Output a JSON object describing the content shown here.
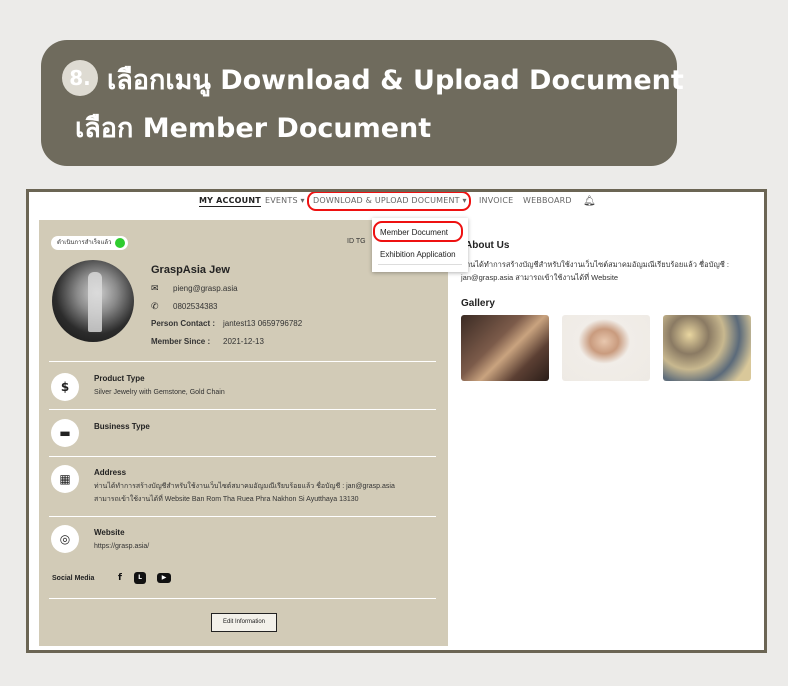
{
  "banner": {
    "step": "8.",
    "line1": "เลือกเมนู Download & Upload Document",
    "line2": "เลือก Member Document"
  },
  "nav": {
    "items": [
      {
        "label": "MY ACCOUNT",
        "active": true
      },
      {
        "label": "EVENTS ▾"
      },
      {
        "label": "DOWNLOAD & UPLOAD DOCUMENT ▾",
        "highlighted": true
      },
      {
        "label": "INVOICE"
      },
      {
        "label": "WEBBOARD"
      }
    ],
    "bell_icon": "bell-icon"
  },
  "dropdown": {
    "items": [
      "Member Document",
      "Exhibition Application"
    ],
    "selected": "Member Document"
  },
  "profile": {
    "status": "ดำเนินการสำเร็จแล้ว",
    "status_color": "#2ecc2e",
    "id_label": "ID TG",
    "name": "GraspAsia Jew",
    "email": "pieng@grasp.asia",
    "phone": "0802534383",
    "person_contact_label": "Person Contact :",
    "person_contact_value": "jantest13 0659796782",
    "member_since_label": "Member Since :",
    "member_since_value": "2021-12-13",
    "sections": [
      {
        "icon": "money-hand-icon",
        "title": "Product Type",
        "value": "Silver Jewelry with Gemstone, Gold Chain"
      },
      {
        "icon": "briefcase-icon",
        "title": "Business Type",
        "value": ""
      },
      {
        "icon": "building-icon",
        "title": "Address",
        "value": "ท่านได้ทำการสร้างบัญชีสำหรับใช้งานเว็บไซต์สมาคมอัญมณีเรียบร้อยแล้ว ชื่อบัญชี : jan@grasp.asia",
        "value2": "สามารถเข้าใช้งานได้ที่ Website Ban Rom Tha Ruea Phra Nakhon Si Ayutthaya 13130"
      },
      {
        "icon": "globe-icon",
        "title": "Website",
        "value": "https://grasp.asia/"
      }
    ],
    "social_label": "Social Media",
    "edit_button": "Edit Information"
  },
  "about": {
    "title": "About Us",
    "text": "ท่านได้ทำการสร้างบัญชีสำหรับใช้งานเว็บไซต์สมาคมอัญมณีเรียบร้อยแล้ว ชื่อบัญชี : jan@grasp.asia สามารถเข้าใช้งานได้ที่ Website"
  },
  "gallery": {
    "title": "Gallery",
    "images": [
      "gallery-image-bracelets",
      "gallery-image-model",
      "gallery-image-rings"
    ]
  },
  "colors": {
    "banner_bg": "#6f6b5d",
    "panel_bg": "#d2cbb7",
    "highlight": "#e11111",
    "frame_border": "#6b6554"
  }
}
